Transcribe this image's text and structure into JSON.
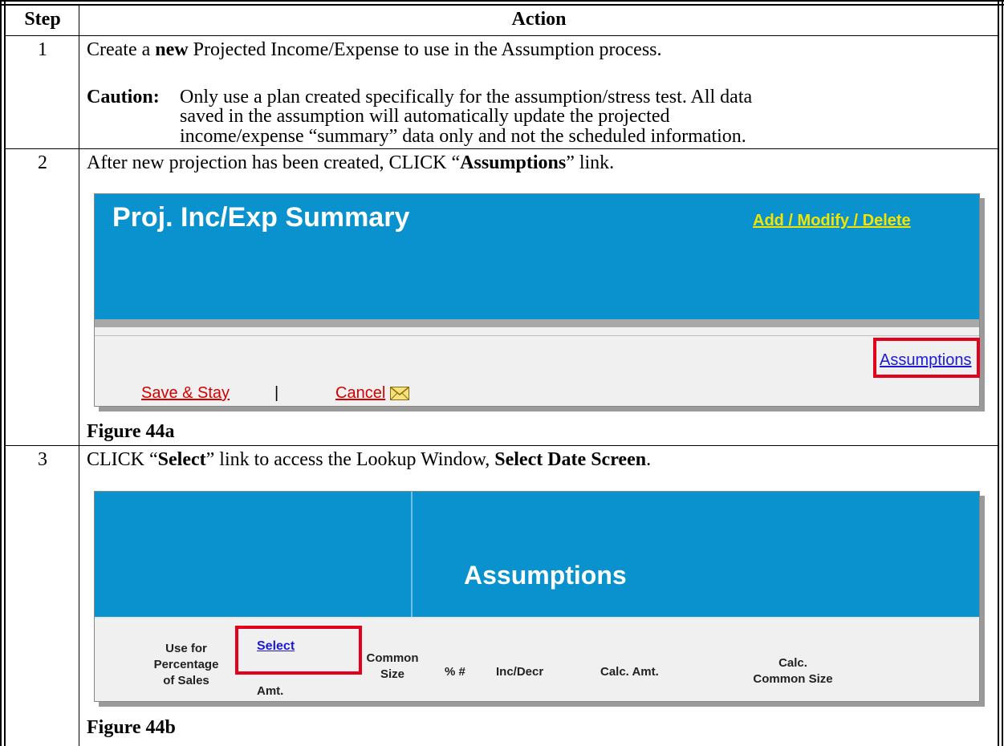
{
  "table": {
    "col_step": "Step",
    "col_action": "Action"
  },
  "rows": [
    {
      "step": "1",
      "line1_pre": "Create a ",
      "line1_bold": "new",
      "line1_post": " Projected Income/Expense to use in the Assumption process.",
      "caution_label": "Caution:",
      "caution_lines": [
        "Only use a plan created specifically for the assumption/stress test. All data",
        "saved in the assumption will automatically update the projected",
        "income/expense “summary” data only and not the scheduled information."
      ]
    },
    {
      "step": "2",
      "text_pre": "After new projection has been created, CLICK “",
      "text_bold": "Assumptions",
      "text_post": "” link.",
      "figure_caption": "Figure 44a"
    },
    {
      "step": "3",
      "text_pre": "CLICK “",
      "text_bold1": "Select",
      "text_mid": "” link to access the Lookup Window, ",
      "text_bold2": "Select Date Screen",
      "text_post": ".",
      "figure_caption": "Figure 44b"
    }
  ],
  "fig44a": {
    "title": "Proj. Inc/Exp Summary",
    "add_modify_delete": "Add / Modify / Delete",
    "assumptions_link": "Assumptions",
    "save_stay": "Save & Stay",
    "separator": "|",
    "cancel": "Cancel",
    "mail_icon": "envelope-icon",
    "colors": {
      "header_blue": "#0a92cf",
      "link_yellow": "#f5e400",
      "link_red": "#d40000",
      "link_blue": "#1a1ad8",
      "highlight": "#e2001a"
    }
  },
  "fig44b": {
    "title": "Assumptions",
    "headers": {
      "use_for": [
        "Use for",
        "Percentage",
        "of Sales"
      ],
      "select_link": "Select",
      "amt": "Amt.",
      "common_size": [
        "Common",
        "Size"
      ],
      "pct": "% #",
      "inc_decr": "Inc/Decr",
      "calc_amt": "Calc. Amt.",
      "calc_common": [
        "Calc.",
        "Common Size"
      ]
    }
  }
}
